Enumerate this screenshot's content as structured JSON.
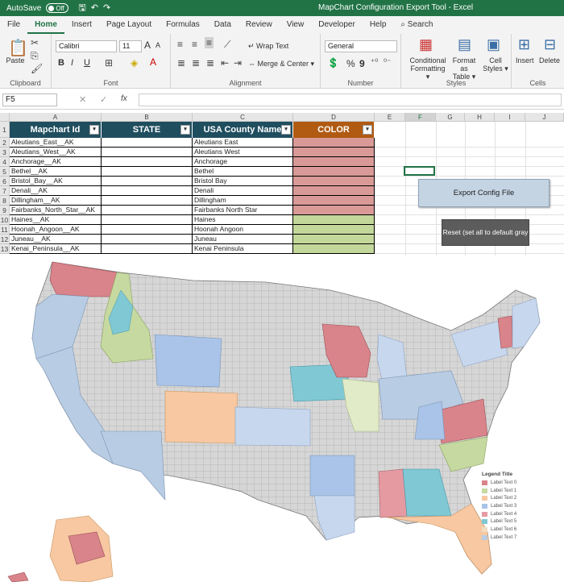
{
  "titlebar": {
    "autosave_label": "AutoSave",
    "autosave_state": "Off",
    "window_title": "MapChart Configuration Export Tool  -  Excel"
  },
  "menu": [
    "File",
    "Home",
    "Insert",
    "Page Layout",
    "Formulas",
    "Data",
    "Review",
    "View",
    "Developer",
    "Help",
    "Search"
  ],
  "ribbon": {
    "clipboard": {
      "paste": "Paste",
      "label": "Clipboard"
    },
    "font": {
      "name": "Calibri",
      "size": "11",
      "label": "Font",
      "bold": "B",
      "italic": "I",
      "underline": "U",
      "grow": "A",
      "shrink": "A"
    },
    "alignment": {
      "wrap": "Wrap Text",
      "merge": "Merge & Center",
      "label": "Alignment"
    },
    "number": {
      "format": "General",
      "pct": "%",
      "comma": "9",
      "label": "Number"
    },
    "styles": {
      "conditional": "Conditional",
      "conditional2": "Formatting",
      "format_as": "Format as",
      "format_as2": "Table",
      "cell": "Cell",
      "cell2": "Styles",
      "label": "Styles"
    },
    "cells": {
      "insert": "Insert",
      "delete": "Delete",
      "label": "Cells"
    }
  },
  "formula": {
    "namebox": "F5",
    "fx": "fx",
    "value": ""
  },
  "columns": [
    "A",
    "B",
    "C",
    "D",
    "E",
    "F",
    "G",
    "H",
    "I",
    "J"
  ],
  "headers": {
    "a": "Mapchart Id",
    "b": "STATE",
    "c": "USA County Name",
    "d": "COLOR"
  },
  "rows": [
    {
      "n": "1"
    },
    {
      "n": "2",
      "id": "Aleutians_East__AK",
      "county": "Aleutians East",
      "color": "#d99a97"
    },
    {
      "n": "3",
      "id": "Aleutians_West__AK",
      "county": "Aleutians West",
      "color": "#d99a97"
    },
    {
      "n": "4",
      "id": "Anchorage__AK",
      "county": "Anchorage",
      "color": "#d99a97"
    },
    {
      "n": "5",
      "id": "Bethel__AK",
      "county": "Bethel",
      "color": "#d99a97"
    },
    {
      "n": "6",
      "id": "Bristol_Bay__AK",
      "county": "Bristol Bay",
      "color": "#d99a97"
    },
    {
      "n": "7",
      "id": "Denali__AK",
      "county": "Denali",
      "color": "#d99a97"
    },
    {
      "n": "8",
      "id": "Dillingham__AK",
      "county": "Dillingham",
      "color": "#d99a97"
    },
    {
      "n": "9",
      "id": "Fairbanks_North_Star__AK",
      "county": "Fairbanks North Star",
      "color": "#d99a97"
    },
    {
      "n": "10",
      "id": "Haines__AK",
      "county": "Haines",
      "color": "#c4d79b"
    },
    {
      "n": "11",
      "id": "Hoonah_Angoon__AK",
      "county": "Hoonah Angoon",
      "color": "#c4d79b"
    },
    {
      "n": "12",
      "id": "Juneau__AK",
      "county": "Juneau",
      "color": "#c4d79b"
    },
    {
      "n": "13",
      "id": "Kenai_Peninsula__AK",
      "county": "Kenai Peninsula",
      "color": "#c4d79b"
    }
  ],
  "buttons": {
    "export": "Export Config File",
    "reset": "Reset (set all to default gray"
  },
  "legend": {
    "title": "Legend Title",
    "items": [
      {
        "label": "Label Text 0",
        "color": "#d9838a"
      },
      {
        "label": "Label Text 1",
        "color": "#c6d9a0"
      },
      {
        "label": "Label Text 2",
        "color": "#f7c8a1"
      },
      {
        "label": "Label Text 3",
        "color": "#a9c4e8"
      },
      {
        "label": "Label Text 4",
        "color": "#e59aa2"
      },
      {
        "label": "Label Text 5",
        "color": "#7fc8d4"
      },
      {
        "label": "Label Text 6",
        "color": "#f2dcc0"
      },
      {
        "label": "Label Text 7",
        "color": "#b8cce4"
      }
    ]
  },
  "colors": {
    "excel_green": "#217346",
    "header_teal": "#1f4e5f",
    "color_header": "#b05a12",
    "map_gray": "#d6d6d6",
    "map_border": "#9a9a9a"
  }
}
